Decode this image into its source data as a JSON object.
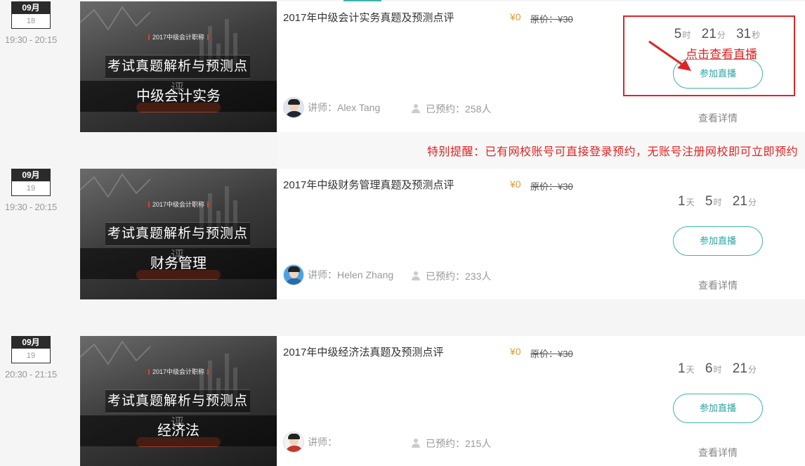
{
  "sessions": [
    {
      "month": "09月",
      "day": "18",
      "time": "19:30 - 20:15",
      "thumb_tag": "2017中级会计职称",
      "thumb_banner": "考试真题解析与预测点评",
      "thumb_subject": "中级会计实务",
      "title": "2017年中级会计实务真题及预测点评",
      "price": "¥0",
      "original_price": "原价：¥30",
      "teacher": "讲师：Alex Tang",
      "booked": "已预约：258人",
      "countdown": [
        {
          "num": "5",
          "unit": "时"
        },
        {
          "num": "21",
          "unit": "分"
        },
        {
          "num": "31",
          "unit": "秒"
        }
      ],
      "join_label": "参加直播",
      "detail_label": "查看详情"
    },
    {
      "month": "09月",
      "day": "19",
      "time": "19:30 - 20:15",
      "thumb_tag": "2017中级会计职称",
      "thumb_banner": "考试真题解析与预测点评",
      "thumb_subject": "财务管理",
      "title": "2017年中级财务管理真题及预测点评",
      "price": "¥0",
      "original_price": "原价：¥30",
      "teacher": "讲师：Helen Zhang",
      "booked": "已预约：233人",
      "countdown": [
        {
          "num": "1",
          "unit": "天"
        },
        {
          "num": "5",
          "unit": "时"
        },
        {
          "num": "21",
          "unit": "分"
        }
      ],
      "join_label": "参加直播",
      "detail_label": "查看详情"
    },
    {
      "month": "09月",
      "day": "19",
      "time": "20:30 - 21:15",
      "thumb_tag": "2017中级会计职称",
      "thumb_banner": "考试真题解析与预测点评",
      "thumb_subject": "经济法",
      "title": "2017年中级经济法真题及预测点评",
      "price": "¥0",
      "original_price": "原价：¥30",
      "teacher": "讲师：",
      "booked": "已预约：215人",
      "countdown": [
        {
          "num": "1",
          "unit": "天"
        },
        {
          "num": "6",
          "unit": "时"
        },
        {
          "num": "21",
          "unit": "分"
        }
      ],
      "join_label": "参加直播",
      "detail_label": "查看详情"
    }
  ],
  "annotation": {
    "click_note": "点击查看直播",
    "color": "#e02424"
  },
  "reminder": "特别提醒：已有网校账号可直接登录预约，无账号注册网校即可立即预约",
  "colors": {
    "accent": "#3fb3b0",
    "price": "#e39b2b",
    "alert": "#e02424"
  }
}
